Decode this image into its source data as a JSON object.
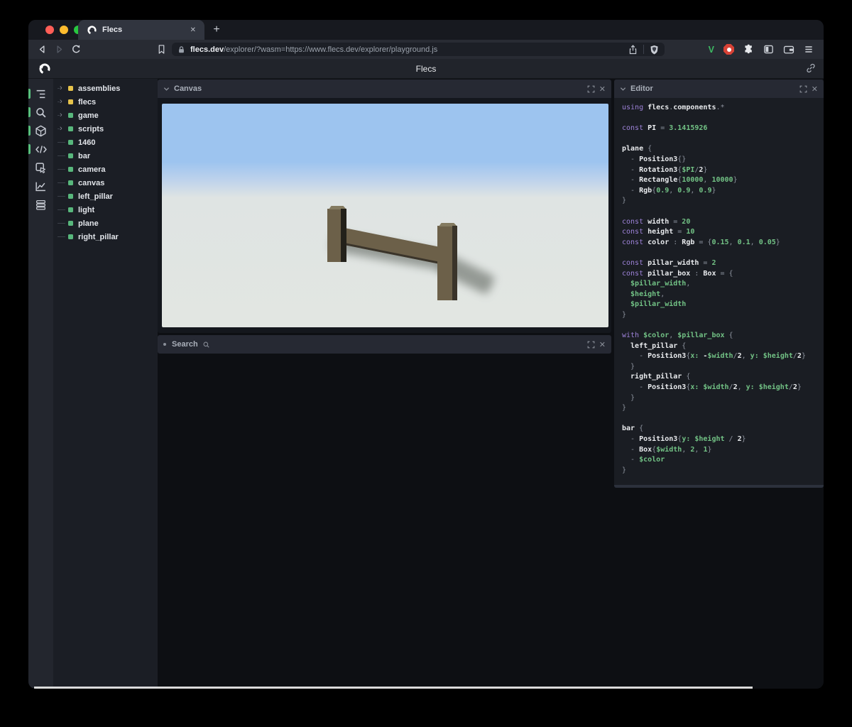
{
  "browser": {
    "tab_title": "Flecs",
    "url_domain": "flecs.dev",
    "url_path": "/explorer/?wasm=https://www.flecs.dev/explorer/playground.js",
    "glyphs": {
      "new_tab": "+",
      "tab_close": "✕",
      "vimium": "V",
      "panel_close": "✕",
      "twisty": "›"
    }
  },
  "app": {
    "title": "Flecs"
  },
  "rail": {
    "items": [
      {
        "name": "entities",
        "icon": "tree-icon",
        "active": true
      },
      {
        "name": "query",
        "icon": "search-icon",
        "active": true
      },
      {
        "name": "world",
        "icon": "cube-icon",
        "active": true
      },
      {
        "name": "scripts",
        "icon": "code-icon",
        "active": true
      },
      {
        "name": "inspect",
        "icon": "pointer-icon",
        "active": false
      },
      {
        "name": "stats",
        "icon": "chart-icon",
        "active": false
      },
      {
        "name": "tables",
        "icon": "rows-icon",
        "active": false
      }
    ]
  },
  "tree": {
    "items": [
      {
        "label": "assemblies",
        "dot": "#e6c34b",
        "expandable": true
      },
      {
        "label": "flecs",
        "dot": "#e6c34b",
        "expandable": true
      },
      {
        "label": "game",
        "dot": "#58b77c",
        "expandable": true
      },
      {
        "label": "scripts",
        "dot": "#58b77c",
        "expandable": true
      },
      {
        "label": "1460",
        "dot": "#58b77c",
        "expandable": false
      },
      {
        "label": "bar",
        "dot": "#58b77c",
        "expandable": false
      },
      {
        "label": "camera",
        "dot": "#58b77c",
        "expandable": false
      },
      {
        "label": "canvas",
        "dot": "#58b77c",
        "expandable": false
      },
      {
        "label": "left_pillar",
        "dot": "#58b77c",
        "expandable": false
      },
      {
        "label": "light",
        "dot": "#58b77c",
        "expandable": false
      },
      {
        "label": "plane",
        "dot": "#58b77c",
        "expandable": false
      },
      {
        "label": "right_pillar",
        "dot": "#58b77c",
        "expandable": false
      }
    ]
  },
  "panels": {
    "canvas_title": "Canvas",
    "search_title": "Search",
    "editor_title": "Editor"
  },
  "scene": {
    "colors": {
      "sky": "#9dc4ef",
      "ground": "#e2e6e2",
      "wood": "#6c6049",
      "wood-light": "#847b61",
      "wood-dark": "#3a342a",
      "wood-darkest": "#23211a",
      "shadow": "#565c55"
    }
  },
  "editor_code": {
    "lines": [
      [
        [
          "kw",
          "using "
        ],
        [
          "id",
          "flecs"
        ],
        [
          "punc",
          "."
        ],
        [
          "id",
          "components"
        ],
        [
          "punc",
          ".*"
        ]
      ],
      [],
      [
        [
          "kw",
          "const "
        ],
        [
          "id",
          "PI"
        ],
        [
          "punc",
          " = "
        ],
        [
          "num",
          "3.1415926"
        ]
      ],
      [],
      [
        [
          "id",
          "plane"
        ],
        [
          "punc",
          " {"
        ]
      ],
      [
        [
          "punc",
          "  - "
        ],
        [
          "id",
          "Position3"
        ],
        [
          "punc",
          "{}"
        ]
      ],
      [
        [
          "punc",
          "  - "
        ],
        [
          "id",
          "Rotation3"
        ],
        [
          "punc",
          "{"
        ],
        [
          "var",
          "$PI"
        ],
        [
          "punc",
          "/"
        ],
        [
          "id",
          "2"
        ],
        [
          "punc",
          "}"
        ]
      ],
      [
        [
          "punc",
          "  - "
        ],
        [
          "id",
          "Rectangle"
        ],
        [
          "punc",
          "{"
        ],
        [
          "num",
          "10000"
        ],
        [
          "punc",
          ", "
        ],
        [
          "num",
          "10000"
        ],
        [
          "punc",
          "}"
        ]
      ],
      [
        [
          "punc",
          "  - "
        ],
        [
          "id",
          "Rgb"
        ],
        [
          "punc",
          "{"
        ],
        [
          "num",
          "0.9"
        ],
        [
          "punc",
          ", "
        ],
        [
          "num",
          "0.9"
        ],
        [
          "punc",
          ", "
        ],
        [
          "num",
          "0.9"
        ],
        [
          "punc",
          "}"
        ]
      ],
      [
        [
          "punc",
          "}"
        ]
      ],
      [],
      [
        [
          "kw",
          "const "
        ],
        [
          "id",
          "width"
        ],
        [
          "punc",
          " = "
        ],
        [
          "num",
          "20"
        ]
      ],
      [
        [
          "kw",
          "const "
        ],
        [
          "id",
          "height"
        ],
        [
          "punc",
          " = "
        ],
        [
          "num",
          "10"
        ]
      ],
      [
        [
          "kw",
          "const "
        ],
        [
          "id",
          "color"
        ],
        [
          "punc",
          " : "
        ],
        [
          "id",
          "Rgb"
        ],
        [
          "punc",
          " = {"
        ],
        [
          "num",
          "0.15"
        ],
        [
          "punc",
          ", "
        ],
        [
          "num",
          "0.1"
        ],
        [
          "punc",
          ", "
        ],
        [
          "num",
          "0.05"
        ],
        [
          "punc",
          "}"
        ]
      ],
      [],
      [
        [
          "kw",
          "const "
        ],
        [
          "id",
          "pillar_width"
        ],
        [
          "punc",
          " = "
        ],
        [
          "num",
          "2"
        ]
      ],
      [
        [
          "kw",
          "const "
        ],
        [
          "id",
          "pillar_box"
        ],
        [
          "punc",
          " : "
        ],
        [
          "id",
          "Box"
        ],
        [
          "punc",
          " = {"
        ]
      ],
      [
        [
          "var",
          "  $pillar_width"
        ],
        [
          "punc",
          ","
        ]
      ],
      [
        [
          "var",
          "  $height"
        ],
        [
          "punc",
          ","
        ]
      ],
      [
        [
          "var",
          "  $pillar_width"
        ]
      ],
      [
        [
          "punc",
          "}"
        ]
      ],
      [],
      [
        [
          "kw",
          "with "
        ],
        [
          "var",
          "$color"
        ],
        [
          "punc",
          ", "
        ],
        [
          "var",
          "$pillar_box"
        ],
        [
          "punc",
          " {"
        ]
      ],
      [
        [
          "id",
          "  left_pillar"
        ],
        [
          "punc",
          " {"
        ]
      ],
      [
        [
          "punc",
          "    - "
        ],
        [
          "id",
          "Position3"
        ],
        [
          "punc",
          "{"
        ],
        [
          "var",
          "x: "
        ],
        [
          "id",
          "-"
        ],
        [
          "var",
          "$width"
        ],
        [
          "punc",
          "/"
        ],
        [
          "id",
          "2"
        ],
        [
          "punc",
          ", "
        ],
        [
          "var",
          "y: "
        ],
        [
          "var",
          "$height"
        ],
        [
          "punc",
          "/"
        ],
        [
          "id",
          "2"
        ],
        [
          "punc",
          "}"
        ]
      ],
      [
        [
          "punc",
          "  }"
        ]
      ],
      [
        [
          "id",
          "  right_pillar"
        ],
        [
          "punc",
          " {"
        ]
      ],
      [
        [
          "punc",
          "    - "
        ],
        [
          "id",
          "Position3"
        ],
        [
          "punc",
          "{"
        ],
        [
          "var",
          "x: "
        ],
        [
          "var",
          "$width"
        ],
        [
          "punc",
          "/"
        ],
        [
          "id",
          "2"
        ],
        [
          "punc",
          ", "
        ],
        [
          "var",
          "y: "
        ],
        [
          "var",
          "$height"
        ],
        [
          "punc",
          "/"
        ],
        [
          "id",
          "2"
        ],
        [
          "punc",
          "}"
        ]
      ],
      [
        [
          "punc",
          "  }"
        ]
      ],
      [
        [
          "punc",
          "}"
        ]
      ],
      [],
      [
        [
          "id",
          "bar"
        ],
        [
          "punc",
          " {"
        ]
      ],
      [
        [
          "punc",
          "  - "
        ],
        [
          "id",
          "Position3"
        ],
        [
          "punc",
          "{"
        ],
        [
          "var",
          "y: "
        ],
        [
          "var",
          "$height"
        ],
        [
          "punc",
          " / "
        ],
        [
          "id",
          "2"
        ],
        [
          "punc",
          "}"
        ]
      ],
      [
        [
          "punc",
          "  - "
        ],
        [
          "id",
          "Box"
        ],
        [
          "punc",
          "{"
        ],
        [
          "var",
          "$width"
        ],
        [
          "punc",
          ", "
        ],
        [
          "num",
          "2"
        ],
        [
          "punc",
          ", "
        ],
        [
          "num",
          "1"
        ],
        [
          "punc",
          "}"
        ]
      ],
      [
        [
          "punc",
          "  - "
        ],
        [
          "var",
          "$color"
        ]
      ],
      [
        [
          "punc",
          "}"
        ]
      ]
    ]
  }
}
